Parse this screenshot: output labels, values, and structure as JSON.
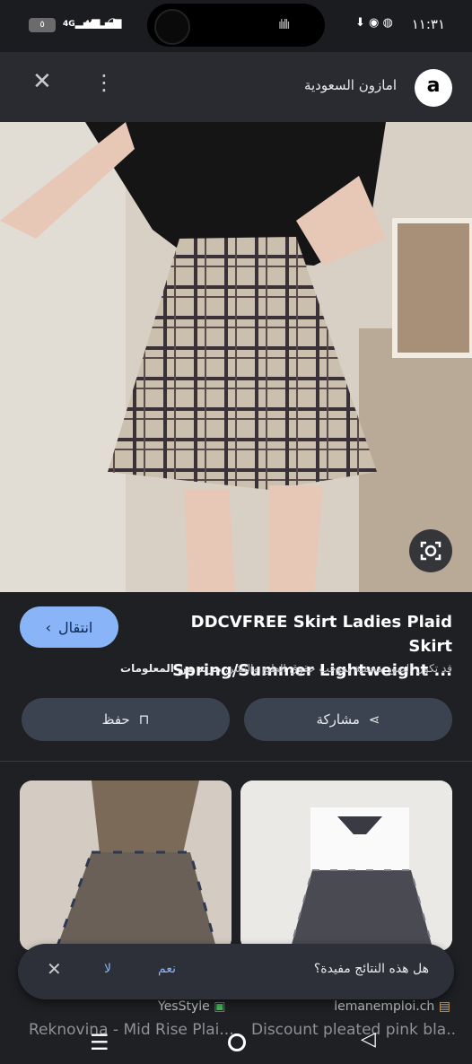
{
  "status_bar": {
    "time": "١١:٣١",
    "battery": "٥",
    "signal_1": "4G",
    "signal_2": "4G"
  },
  "header": {
    "site_title": "امازون السعودية",
    "logo_letter": "a"
  },
  "product": {
    "title_line1": "DDCVFREE Skirt Ladies Plaid Skirt",
    "title_line2": "Spring/Summer Lightweight ...",
    "visit_label": "انتقال",
    "notice_text": "قد تكون الصور محمية بموجب حقوق الطبع والنشر.",
    "notice_more": "مزيد من المعلومات"
  },
  "actions": {
    "share_label": "مشاركة",
    "save_label": "حفظ"
  },
  "feedback": {
    "question": "هل هذه النتائج مفيدة؟",
    "yes": "نعم",
    "no": "لا"
  },
  "related": [
    {
      "source": "YesStyle",
      "caption": "Reknovina - Mid Rise Plai..."
    },
    {
      "source": "lemanemploi.ch",
      "caption": "Discount pleated pink bla..."
    }
  ],
  "colors": {
    "background": "#1f2024",
    "accent": "#8ab4f8",
    "button": "#3c4350"
  }
}
